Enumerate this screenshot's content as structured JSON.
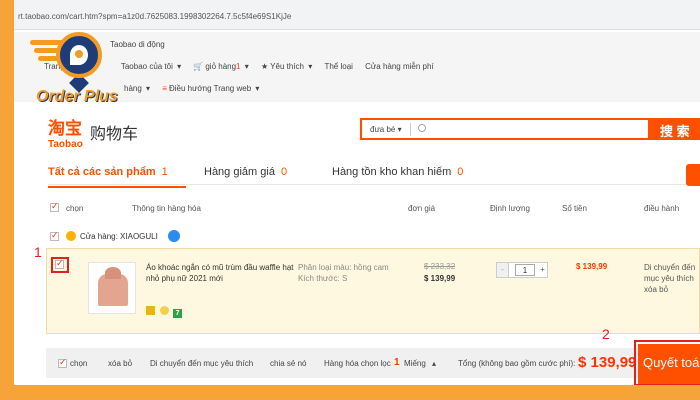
{
  "url": "rt.taobao.com/cart.htm?spm=a1z0d.7625083.1998302264.7.5c5f4e69S1KjJe",
  "topnav": {
    "row1": [
      "Taobao di động"
    ],
    "row2": [
      "Trang",
      "Taobao của tôi",
      "giỏ hàng",
      "Yêu thích",
      "Thể loại",
      "Cửa hàng miễn phí"
    ],
    "cart_count": "1",
    "row3": [
      "hàng",
      "Điều hướng Trang web"
    ]
  },
  "brand": {
    "name": "Order Plus"
  },
  "taobao": {
    "logo_cn": "淘宝",
    "logo_en": "Taobao",
    "cart_title": "购物车"
  },
  "search": {
    "scope": "đưa bé",
    "button": "搜 索"
  },
  "tabs": [
    {
      "label": "Tất cả các sản phẩm",
      "count": "1"
    },
    {
      "label": "Hàng giảm giá",
      "count": "0"
    },
    {
      "label": "Hàng tồn kho khan hiếm",
      "count": "0"
    }
  ],
  "table_headers": [
    "chọn",
    "Thông tin hàng hóa",
    "đơn giá",
    "Định lượng",
    "Số tiền",
    "điều hành"
  ],
  "shop": {
    "label": "Cửa hàng: XIAOGULI"
  },
  "item": {
    "title": "Áo khoác ngắn có mũ trùm đầu waffle hạt nhỏ phụ nữ 2021 mới",
    "attr_color": "Phân loại màu: hồng cam",
    "attr_size": "Kích thước: S",
    "price_old": "$ 233,32",
    "price_new": "$ 139,99",
    "quantity": "1",
    "sum": "$ 139,99",
    "ops": [
      "Di chuyển đến",
      "mục yêu thích",
      "xóa bỏ"
    ],
    "badge_3": "7"
  },
  "annotations": {
    "step1": "1",
    "step2": "2"
  },
  "footer": {
    "select": "chọn",
    "remove": "xóa bỏ",
    "move_fav": "Di chuyển đến mục yêu thích",
    "share": "chia sẻ nó",
    "selected_label": "Hàng hóa chọn lọc",
    "selected_count": "1",
    "unit": "Miếng",
    "total_label": "Tổng (không bao gồm cước phí):",
    "total": "$ 139,99",
    "checkout": "Quyết toán"
  }
}
